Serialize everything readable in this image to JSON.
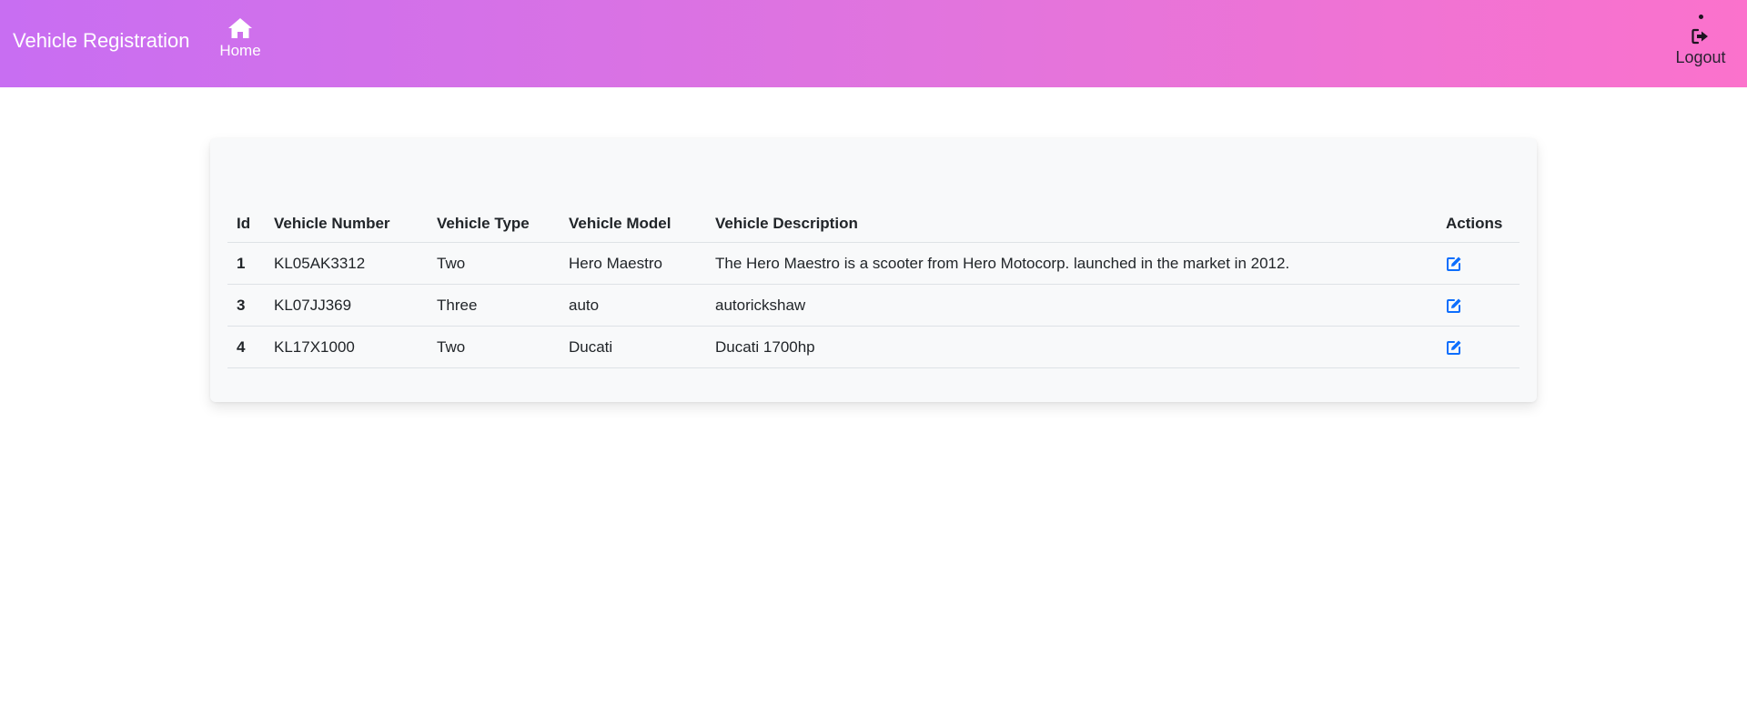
{
  "navbar": {
    "brand": "Vehicle Registration",
    "home_label": "Home",
    "home_icon": "home-icon",
    "logout_label": "Logout",
    "logout_icon": "sign-out-icon",
    "colors": {
      "gradient_start": "#c86ef2",
      "gradient_end": "#fb72cc"
    }
  },
  "table": {
    "headers": [
      "Id",
      "Vehicle Number",
      "Vehicle Type",
      "Vehicle Model",
      "Vehicle Description",
      "Actions"
    ],
    "rows": [
      {
        "id": "1",
        "number": "KL05AK3312",
        "type": "Two",
        "model": "Hero Maestro",
        "description": "The Hero Maestro is a scooter from Hero Motocorp. launched in the market in 2012.",
        "action_icon": "edit-icon"
      },
      {
        "id": "3",
        "number": "KL07JJ369",
        "type": "Three",
        "model": "auto",
        "description": "autorickshaw",
        "action_icon": "edit-icon"
      },
      {
        "id": "4",
        "number": "KL17X1000",
        "type": "Two",
        "model": "Ducati",
        "description": "Ducati 1700hp",
        "action_icon": "edit-icon"
      }
    ],
    "colors": {
      "edit_icon": "#0d6efd",
      "card_bg": "#f8f9fa"
    }
  }
}
